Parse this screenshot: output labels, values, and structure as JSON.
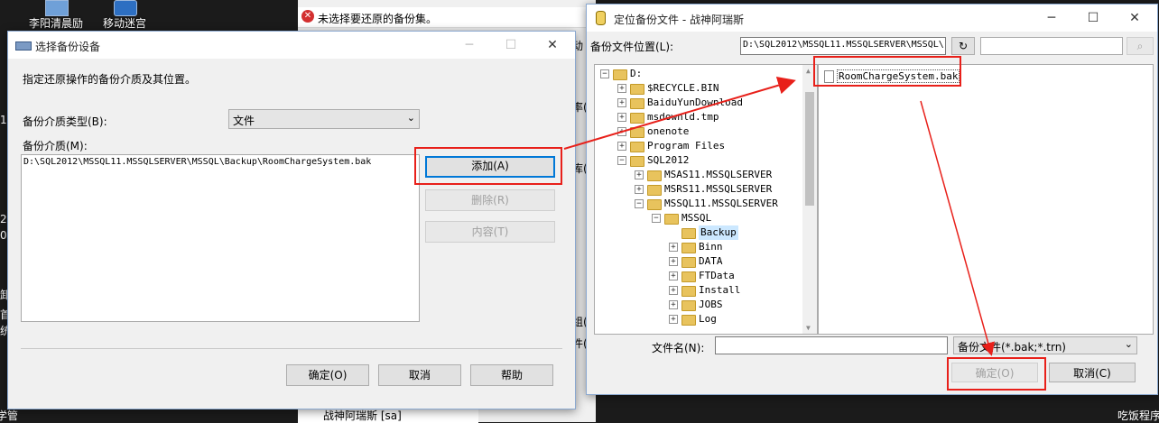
{
  "desktop": {
    "icons": [
      {
        "label": "站"
      },
      {
        "label": "李阳清晨励"
      },
      {
        "label": "移动迷宫"
      }
    ],
    "side_fragments": [
      "1",
      "2",
      "0",
      "1",
      "8",
      "卸",
      "首",
      "统",
      "学管"
    ],
    "right_fragments": [
      "吃饭程序"
    ]
  },
  "background_app": {
    "error_text": "未选择要还原的备份集。",
    "fragments": [
      "动",
      "率(",
      "库(",
      "组(",
      "件("
    ],
    "taskbar_item": "战神阿瑞斯 [sa]"
  },
  "select_device": {
    "title": "选择备份设备",
    "instruction": "指定还原操作的备份介质及其位置。",
    "media_type_label": "备份介质类型(B):",
    "media_type_value": "文件",
    "media_label": "备份介质(M):",
    "media_items": [
      "D:\\SQL2012\\MSSQL11.MSSQLSERVER\\MSSQL\\Backup\\RoomChargeSystem.bak"
    ],
    "add_button": "添加(A)",
    "remove_button": "删除(R)",
    "contents_button": "内容(T)",
    "ok_button": "确定(O)",
    "cancel_button": "取消",
    "help_button": "帮助"
  },
  "locate_file": {
    "title": "定位备份文件 - 战神阿瑞斯",
    "location_label": "备份文件位置(L):",
    "location_value": "D:\\SQL2012\\MSSQL11.MSSQLSERVER\\MSSQL\\",
    "search_value": "",
    "tree": [
      {
        "label": "D:",
        "level": 0,
        "toggle": "-"
      },
      {
        "label": "$RECYCLE.BIN",
        "level": 1,
        "toggle": "+"
      },
      {
        "label": "BaiduYunDownload",
        "level": 1,
        "toggle": "+"
      },
      {
        "label": "msdownld.tmp",
        "level": 1,
        "toggle": "+"
      },
      {
        "label": "onenote",
        "level": 1,
        "toggle": "+"
      },
      {
        "label": "Program Files",
        "level": 1,
        "toggle": "+"
      },
      {
        "label": "SQL2012",
        "level": 1,
        "toggle": "-"
      },
      {
        "label": "MSAS11.MSSQLSERVER",
        "level": 2,
        "toggle": "+"
      },
      {
        "label": "MSRS11.MSSQLSERVER",
        "level": 2,
        "toggle": "+"
      },
      {
        "label": "MSSQL11.MSSQLSERVER",
        "level": 2,
        "toggle": "-"
      },
      {
        "label": "MSSQL",
        "level": 3,
        "toggle": "-"
      },
      {
        "label": "Backup",
        "level": 4,
        "toggle": "",
        "selected": true
      },
      {
        "label": "Binn",
        "level": 4,
        "toggle": "+"
      },
      {
        "label": "DATA",
        "level": 4,
        "toggle": "+"
      },
      {
        "label": "FTData",
        "level": 4,
        "toggle": "+"
      },
      {
        "label": "Install",
        "level": 4,
        "toggle": "+"
      },
      {
        "label": "JOBS",
        "level": 4,
        "toggle": "+"
      },
      {
        "label": "Log",
        "level": 4,
        "toggle": "+"
      }
    ],
    "files": [
      "RoomChargeSystem.bak"
    ],
    "filename_label": "文件名(N):",
    "filename_value": "",
    "filetype_value": "备份文件(*.bak;*.trn)",
    "ok_button": "确定(O)",
    "cancel_button": "取消(C)"
  },
  "colors": {
    "annotation": "#e8201a",
    "focus": "#0078d7"
  }
}
